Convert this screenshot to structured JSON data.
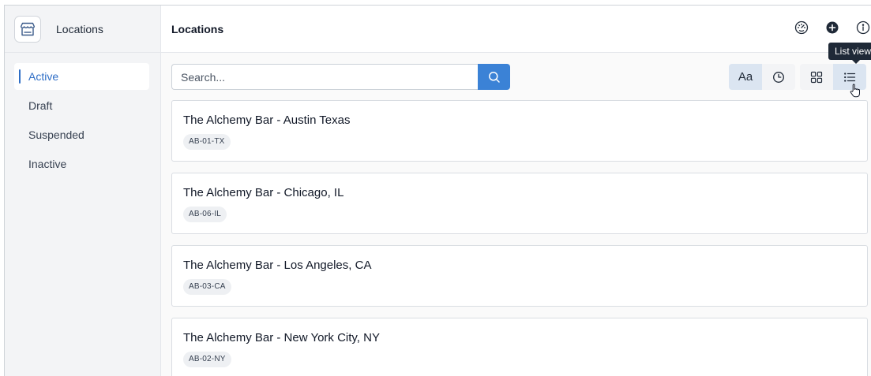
{
  "sidebar": {
    "app_title": "Locations",
    "app_icon": "storefront-icon",
    "items": [
      {
        "label": "Active",
        "active": true
      },
      {
        "label": "Draft",
        "active": false
      },
      {
        "label": "Suspended",
        "active": false
      },
      {
        "label": "Inactive",
        "active": false
      }
    ]
  },
  "header": {
    "title": "Locations",
    "actions": [
      "dashboard-gauge-icon",
      "add-circle-icon",
      "info-icon"
    ]
  },
  "toolbar": {
    "search_placeholder": "Search...",
    "search_value": "",
    "sort_alpha_label": "Aa",
    "sort_alpha_active": true,
    "sort_recent_icon": "clock-icon",
    "grid_view_icon": "grid-icon",
    "list_view_icon": "list-icon",
    "list_view_active": true,
    "tooltip": "List view"
  },
  "locations": [
    {
      "name": "The Alchemy Bar - Austin Texas",
      "code": "AB-01-TX"
    },
    {
      "name": "The Alchemy Bar - Chicago, IL",
      "code": "AB-06-IL"
    },
    {
      "name": "The Alchemy Bar - Los Angeles, CA",
      "code": "AB-03-CA"
    },
    {
      "name": "The Alchemy Bar - New York City, NY",
      "code": "AB-02-NY"
    }
  ],
  "colors": {
    "accent": "#2f6ec6",
    "search_button": "#3b82d6",
    "toggle_active": "#dbe5f1",
    "sidebar_bg": "#f3f4f6"
  }
}
